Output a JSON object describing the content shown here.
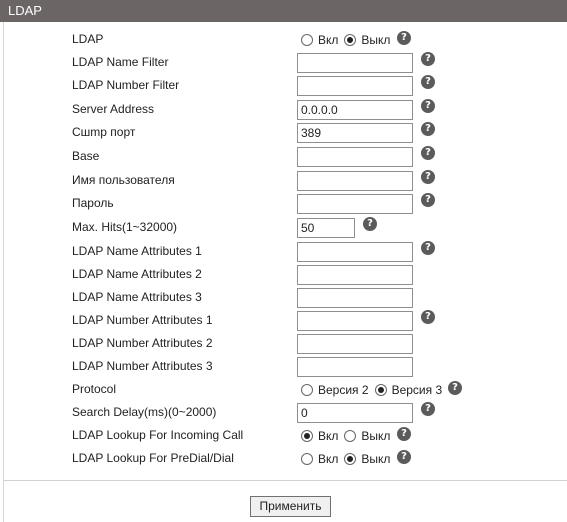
{
  "header": {
    "title": "LDAP"
  },
  "fields": [
    {
      "label": "LDAP",
      "type": "radio",
      "options": [
        "Вкл",
        "Выкл"
      ],
      "selected": 1,
      "help": true
    },
    {
      "label": "LDAP Name Filter",
      "type": "text",
      "value": "",
      "help": true
    },
    {
      "label": "LDAP Number Filter",
      "type": "text",
      "value": "",
      "help": true
    },
    {
      "label": "Server Address",
      "type": "text",
      "value": "0.0.0.0",
      "help": true
    },
    {
      "label": "Сшmp порт",
      "type": "text",
      "value": "389",
      "help": true
    },
    {
      "label": "Base",
      "type": "text",
      "value": "",
      "help": true
    },
    {
      "label": "Имя пользователя",
      "type": "text",
      "value": "",
      "help": true
    },
    {
      "label": "Пароль",
      "type": "text",
      "value": "",
      "help": true
    },
    {
      "label": "Max. Hits(1~32000)",
      "type": "text-short",
      "value": "50",
      "help": true
    },
    {
      "label": "LDAP Name Attributes 1",
      "type": "text",
      "value": "",
      "help": true
    },
    {
      "label": "LDAP Name Attributes 2",
      "type": "text",
      "value": "",
      "help": false
    },
    {
      "label": "LDAP Name Attributes 3",
      "type": "text",
      "value": "",
      "help": false
    },
    {
      "label": "LDAP Number Attributes 1",
      "type": "text",
      "value": "",
      "help": true
    },
    {
      "label": "LDAP Number Attributes 2",
      "type": "text",
      "value": "",
      "help": false
    },
    {
      "label": "LDAP Number Attributes 3",
      "type": "text",
      "value": "",
      "help": false
    },
    {
      "label": "Protocol",
      "type": "radio",
      "options": [
        "Версия 2",
        "Версия 3"
      ],
      "selected": 1,
      "help": true
    },
    {
      "label": "Search Delay(ms)(0~2000)",
      "type": "text",
      "value": "0",
      "help": true
    },
    {
      "label": "LDAP Lookup For Incoming Call",
      "type": "radio",
      "options": [
        "Вкл",
        "Выкл"
      ],
      "selected": 0,
      "help": true
    },
    {
      "label": "LDAP Lookup For PreDial/Dial",
      "type": "radio",
      "options": [
        "Вкл",
        "Выкл"
      ],
      "selected": 1,
      "help": true
    }
  ],
  "help_icon": "question-icon",
  "apply_button": {
    "label": "Применить"
  }
}
